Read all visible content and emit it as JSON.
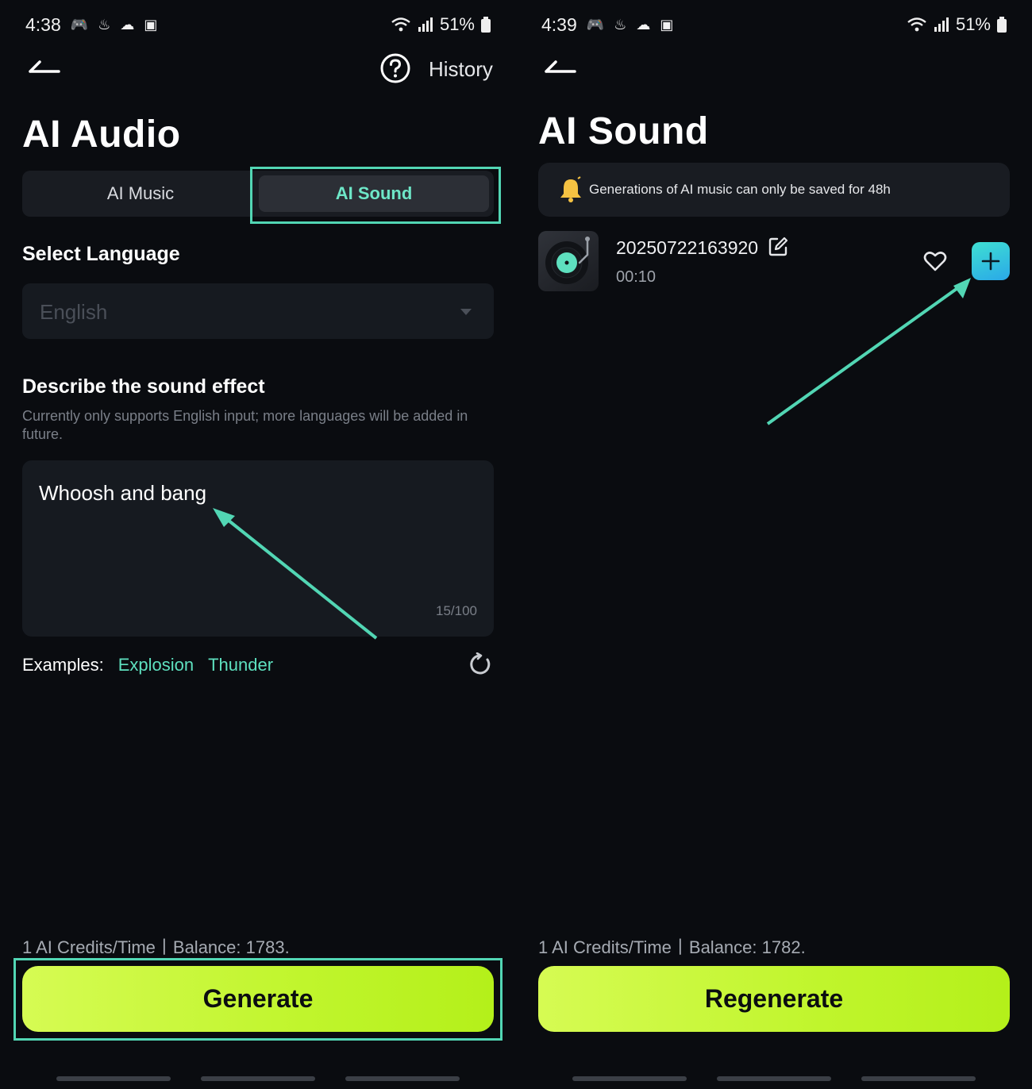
{
  "left": {
    "status": {
      "time": "4:38",
      "battery": "51%"
    },
    "header": {
      "history_label": "History"
    },
    "title": "AI Audio",
    "tabs": [
      {
        "label": "AI Music"
      },
      {
        "label": "AI Sound"
      }
    ],
    "language": {
      "label": "Select Language",
      "value": "English"
    },
    "describe": {
      "label": "Describe the sound effect",
      "hint": "Currently only supports English input; more languages will be added in future.",
      "text": "Whoosh and bang",
      "counter": "15/100"
    },
    "examples": {
      "label": "Examples:",
      "items": [
        "Explosion",
        "Thunder"
      ]
    },
    "credits": "1 AI Credits/Time丨Balance: 1783.",
    "button_label": "Generate"
  },
  "right": {
    "status": {
      "time": "4:39",
      "battery": "51%"
    },
    "title": "AI Sound",
    "notice": "Generations of AI music can only be saved for 48h",
    "track": {
      "name": "20250722163920",
      "duration": "00:10"
    },
    "credits": "1 AI Credits/Time丨Balance: 1782.",
    "button_label": "Regenerate"
  },
  "colors": {
    "accent": "#52d6b4",
    "button": "#c8f83a",
    "background": "#0a0c10"
  }
}
